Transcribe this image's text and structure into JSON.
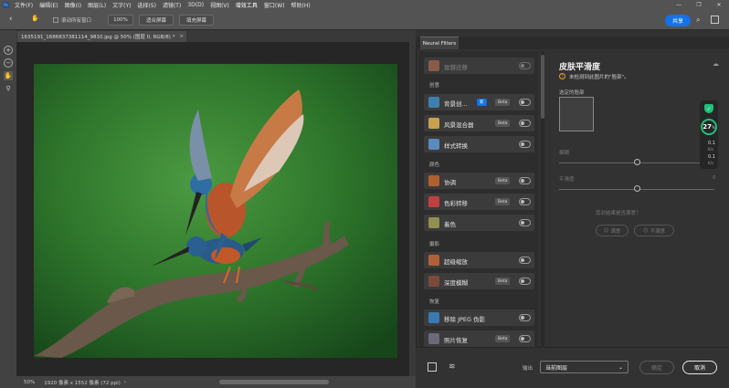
{
  "menu": {
    "logo": "Ps",
    "items": [
      "文件(F)",
      "编辑(E)",
      "图像(I)",
      "图层(L)",
      "文字(Y)",
      "选择(S)",
      "滤镜(T)",
      "3D(D)",
      "视图(V)",
      "增效工具",
      "窗口(W)",
      "帮助(H)"
    ]
  },
  "window_controls": {
    "minimize": "—",
    "restore": "❐",
    "close": "✕"
  },
  "options_bar": {
    "scroll_all_label": "滚动所有窗口",
    "zoom_btn": "100%",
    "fit_screen_btn": "适合屏幕",
    "fill_screen_btn": "填充屏幕",
    "share_btn": "共享"
  },
  "document": {
    "tab_title": "1635191_1686837381114_9810.jpg @ 50% (图层 0, RGB/8) *",
    "zoom": "50%",
    "dimensions": "1920 像素 x 1552 像素 (72 ppi)"
  },
  "neural_filters": {
    "tab": "Neural Filters",
    "items": [
      {
        "label": "妆容迁移",
        "cat": null,
        "icon": "#8a5a4a"
      },
      {
        "cat": "创意"
      },
      {
        "label": "背景创...",
        "badge_new": "新",
        "badge": "Beta",
        "icon": "#3f7fb0"
      },
      {
        "label": "风景混合器",
        "badge": "Beta",
        "icon": "#c8a050"
      },
      {
        "label": "样式转换",
        "icon": "#5a8ac0"
      },
      {
        "cat": "颜色"
      },
      {
        "label": "协调",
        "badge": "Beta",
        "icon": "#b06030"
      },
      {
        "label": "色彩转移",
        "badge": "Beta",
        "icon": "#c04040"
      },
      {
        "label": "着色",
        "icon": "#909050"
      },
      {
        "cat": "摄影"
      },
      {
        "label": "超级缩放",
        "icon": "#b0603a"
      },
      {
        "label": "深度模糊",
        "badge": "Beta",
        "icon": "#7a4a3a"
      },
      {
        "cat": "恢复"
      },
      {
        "label": "移除 JPEG 伪影",
        "icon": "#3a7ab0"
      },
      {
        "label": "照片恢复",
        "badge": "Beta",
        "icon": "#6a6a7a"
      }
    ]
  },
  "detail": {
    "title": "皮肤平滑度",
    "warning": "未检测到此图片的\"脸部\"。",
    "selected_face_label": "选定的脸部",
    "blur_label": "模糊",
    "blur_value": "0",
    "smooth_label": "平滑度",
    "smooth_value": "0",
    "feedback_question": "您对结果是否满意？",
    "satisfied_btn": "满意",
    "unsatisfied_btn": "不满意"
  },
  "bottom": {
    "output_label": "输出",
    "output_value": "当前图层",
    "ok_btn": "确定",
    "cancel_btn": "取消"
  },
  "stats": {
    "value": "27",
    "unit": "%",
    "up": "0.1",
    "up_unit": "K/s",
    "down": "0.1",
    "down_unit": "K/s"
  },
  "colors": {
    "accent": "#1473e6",
    "panel": "#323232",
    "new_badge": "#1473e6"
  }
}
